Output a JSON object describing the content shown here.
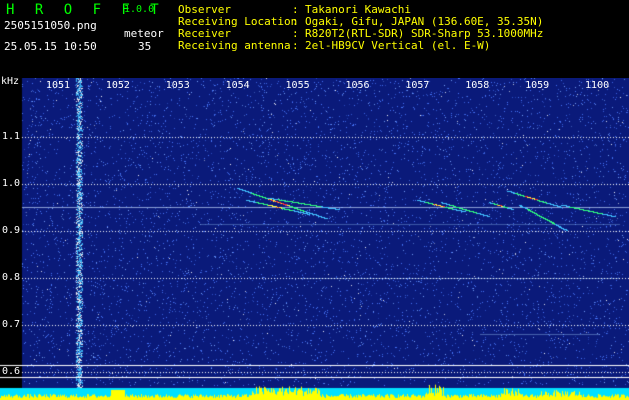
{
  "header": {
    "brand": "H R O F F T",
    "version": "1.0.0",
    "filename": "2505151050.png",
    "timestamp": "25.05.15 10:50",
    "meteor_label": "meteor",
    "meteor_count": "35",
    "info": [
      {
        "label": "Observer",
        "sep": ":",
        "value": "Takanori Kawachi"
      },
      {
        "label": "Receiving Location",
        "sep": ":",
        "value": "Ogaki, Gifu, JAPAN (136.60E, 35.35N)"
      },
      {
        "label": "Receiver",
        "sep": ":",
        "value": "R820T2(RTL-SDR) SDR-Sharp 53.1000MHz"
      },
      {
        "label": "Receiving antenna",
        "sep": ":",
        "value": "2el-HB9CV Vertical (el. E-W)"
      }
    ]
  },
  "spectrogram": {
    "unit": "kHz",
    "x_ticks": [
      "1051",
      "1052",
      "1053",
      "1054",
      "1055",
      "1056",
      "1057",
      "1058",
      "1059",
      "1100"
    ],
    "y_ticks": [
      "1.1",
      "1.0",
      "0.9",
      "0.8",
      "0.7",
      "0.6"
    ],
    "y_values": [
      1.1,
      1.0,
      0.9,
      0.8,
      0.7,
      0.6
    ],
    "y_range": [
      0.57,
      1.2
    ],
    "x_range_minutes": [
      0,
      10.0
    ],
    "colors": {
      "background": "#0a1a7a",
      "noise": "#4a7aff",
      "grid": "#ffffff",
      "signal_hot": "#ff3030",
      "signal_mid": "#30ff80",
      "signal_low": "#40c0ff",
      "level_bar": "#ffff00",
      "level_base": "#00e0ff"
    }
  }
}
